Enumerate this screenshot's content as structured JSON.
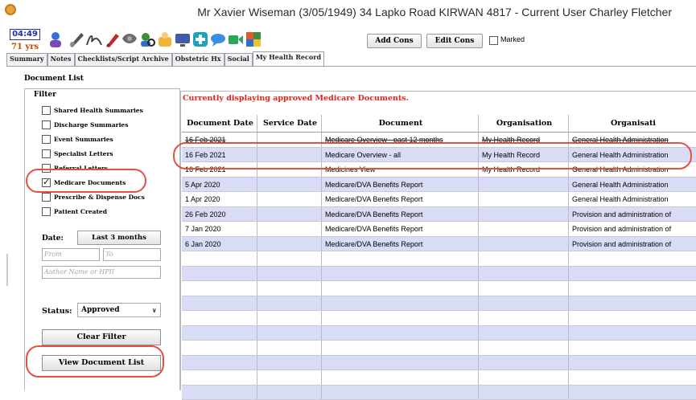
{
  "window": {
    "title": "Mr Xavier Wiseman (3/05/1949) 34 Lapko Road KIRWAN 4817 - Current User Charley Fletcher"
  },
  "toolbar": {
    "clock": "04:49",
    "age": "71 yrs",
    "add_cons": "Add Cons",
    "edit_cons": "Edit Cons",
    "marked_label": "Marked",
    "icons": [
      "patient-icon",
      "pen-icon",
      "signature-icon",
      "pencil-icon",
      "scanner-icon",
      "search-user-icon",
      "drug-icon",
      "monitor-icon",
      "plus-icon",
      "chat-icon",
      "video-icon",
      "puzzle-icon"
    ]
  },
  "tabs": [
    "Summary",
    "Notes",
    "Checklists/Script Archive",
    "Obstetric Hx",
    "Social",
    "My Health Record"
  ],
  "active_tab": "My Health Record",
  "doc_list": {
    "label": "Document List",
    "filter_label": "Filter",
    "filters": [
      {
        "label": "Shared Health Summaries",
        "checked": false
      },
      {
        "label": "Discharge Summaries",
        "checked": false
      },
      {
        "label": "Event Summaries",
        "checked": false
      },
      {
        "label": "Specialist Letters",
        "checked": false
      },
      {
        "label": "Referral Letters",
        "checked": false
      },
      {
        "label": "Medicare Documents",
        "checked": true
      },
      {
        "label": "Prescribe & Dispense Docs",
        "checked": false
      },
      {
        "label": "Patient Created",
        "checked": false
      }
    ],
    "date_label": "Date:",
    "date_button": "Last 3 months",
    "from_placeholder": "From",
    "to_placeholder": "To",
    "author_placeholder": "Author Name or HPII",
    "status_label": "Status:",
    "status_value": "Approved",
    "clear_filter": "Clear Filter",
    "view_list": "View Document List"
  },
  "message": "Currently displaying approved Medicare Documents.",
  "table": {
    "headers": [
      "Document Date",
      "Service Date",
      "Document",
      "Organisation",
      "Organisati"
    ],
    "rows": [
      [
        "16 Feb 2021",
        "",
        "Medicare Overview - past 12 months",
        "My Health Record",
        "General Health Administration"
      ],
      [
        "16 Feb 2021",
        "",
        "Medicare Overview - all",
        "My Health Record",
        "General Health Administration"
      ],
      [
        "16 Feb 2021",
        "",
        "Medicines View",
        "My Health Record",
        "General Health Administration"
      ],
      [
        "5 Apr 2020",
        "",
        "Medicare/DVA Benefits Report",
        "",
        "General Health Administration"
      ],
      [
        "1 Apr 2020",
        "",
        "Medicare/DVA Benefits Report",
        "",
        "General Health Administration"
      ],
      [
        "26 Feb 2020",
        "",
        "Medicare/DVA Benefits Report",
        "",
        "Provision and administration of"
      ],
      [
        "7 Jan 2020",
        "",
        "Medicare/DVA Benefits Report",
        "",
        "Provision and administration of"
      ],
      [
        "6 Jan 2020",
        "",
        "Medicare/DVA Benefits Report",
        "",
        "Provision and administration of"
      ],
      [
        "",
        "",
        "",
        "",
        ""
      ],
      [
        "",
        "",
        "",
        "",
        ""
      ],
      [
        "",
        "",
        "",
        "",
        ""
      ],
      [
        "",
        "",
        "",
        "",
        ""
      ],
      [
        "",
        "",
        "",
        "",
        ""
      ],
      [
        "",
        "",
        "",
        "",
        ""
      ],
      [
        "",
        "",
        "",
        "",
        ""
      ],
      [
        "",
        "",
        "",
        "",
        ""
      ],
      [
        "",
        "",
        "",
        "",
        ""
      ],
      [
        "",
        "",
        "",
        "",
        ""
      ]
    ]
  },
  "colors": {
    "alt_row": "#d9dcf5",
    "highlight": "#e2513f",
    "message": "#e0251f"
  }
}
